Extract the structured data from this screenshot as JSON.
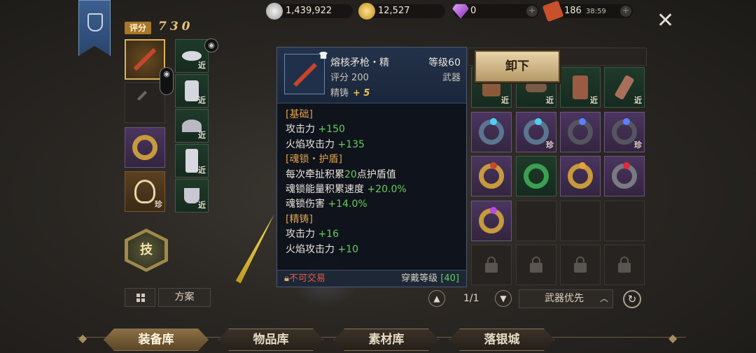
{
  "score": {
    "label": "评分",
    "value": "730"
  },
  "currencies": [
    {
      "name": "silver",
      "value": "1,439,922",
      "icon": "silver-coin-icon",
      "color": "#c0c0c0"
    },
    {
      "name": "gold",
      "value": "12,527",
      "icon": "gold-coin-icon",
      "color": "#e0b03a"
    },
    {
      "name": "diamond",
      "value": "0",
      "icon": "diamond-icon",
      "color": "#b85ce0"
    },
    {
      "name": "ticket",
      "value": "186",
      "timer": "38:59",
      "icon": "ticket-icon",
      "color": "#c8502a"
    }
  ],
  "equipment_left": {
    "small_slots": [
      "近",
      "近",
      "近",
      "近",
      "近"
    ],
    "slot_tag": "珍"
  },
  "skill_label": "技",
  "plan_label": "方案",
  "tooltip": {
    "name": "熔核矛枪・精",
    "level": "等级60",
    "score": "评分 200",
    "type": "武器",
    "forge_label": "精铸",
    "forge_value": "+ 5",
    "basic_title": "[基础]",
    "atk_label": "攻击力",
    "atk_value": "+150",
    "fire_label": "火焰攻击力",
    "fire_value": "+135",
    "soul_title": "[魂锁・护盾]",
    "soul_line1_a": "每次牵扯积累",
    "soul_line1_b": "20",
    "soul_line1_c": "点护盾值",
    "soul_speed_label": "魂锁能量积累速度",
    "soul_speed_value": "+20.0%",
    "soul_dmg_label": "魂锁伤害",
    "soul_dmg_value": "+14.0%",
    "forge_title": "[精铸]",
    "f_atk_label": "攻击力",
    "f_atk_value": "+16",
    "f_fire_label": "火焰攻击力",
    "f_fire_value": "+10",
    "no_trade": "不可交易",
    "wear_label": "穿戴等级",
    "wear_value": "[40]"
  },
  "unequip_label": "卸下",
  "inventory_tags": {
    "near": "近",
    "rare": "珍"
  },
  "pager": {
    "text": "1/1"
  },
  "sort_label": "武器优先",
  "tabs": [
    "装备库",
    "物品库",
    "素材库",
    "落银城"
  ],
  "colors": {
    "accent": "#d9b25e",
    "green": "#62d05a",
    "orange": "#e0a24c",
    "red": "#e05a48"
  }
}
